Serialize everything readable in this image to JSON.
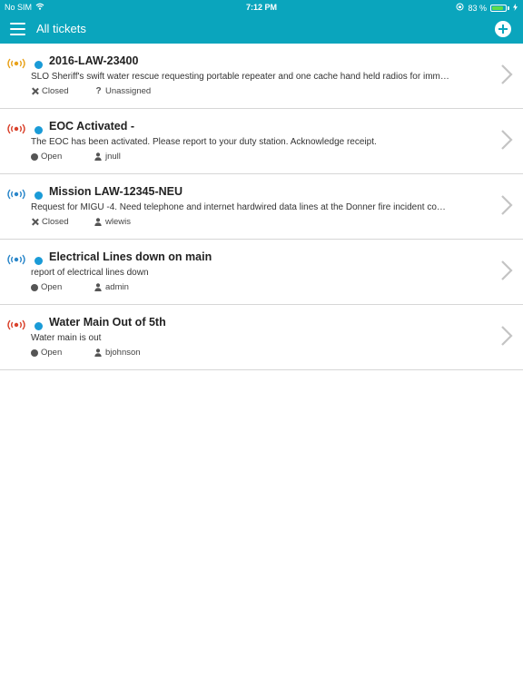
{
  "status_bar": {
    "carrier": "No SIM",
    "time": "7:12 PM",
    "battery_percent_text": "83 %",
    "battery_level": 0.83,
    "battery_color": "#5ddc4a"
  },
  "navbar": {
    "title": "All tickets",
    "background": "#0aa5bd",
    "menu_icon": "hamburger-menu-icon",
    "add_icon": "plus-circle-icon"
  },
  "tickets": [
    {
      "title": "2016-LAW-23400",
      "description": "SLO Sheriff's swift water rescue requesting portable repeater and one cache hand held radios for imm…",
      "status": "Closed",
      "status_icon": "close-icon",
      "assignee": "Unassigned",
      "assignee_icon": "question-icon",
      "priority_color": "#e8a21a",
      "unread_color": "#1a9bd7"
    },
    {
      "title": "EOC Activated -",
      "description": "The EOC has been activated. Please report to your duty station. Acknowledge receipt.",
      "status": "Open",
      "status_icon": "open-circle-icon",
      "assignee": "jnull",
      "assignee_icon": "person-icon",
      "priority_color": "#d9412b",
      "unread_color": "#1a9bd7"
    },
    {
      "title": "Mission LAW-12345-NEU",
      "description": "Request for MIGU -4. Need telephone and internet hardwired data lines at the Donner fire incident co…",
      "status": "Closed",
      "status_icon": "close-icon",
      "assignee": "wlewis",
      "assignee_icon": "person-icon",
      "priority_color": "#2a86c9",
      "unread_color": "#1a9bd7"
    },
    {
      "title": "Electrical Lines down on main",
      "description": "report of electrical lines down",
      "status": "Open",
      "status_icon": "open-circle-icon",
      "assignee": "admin",
      "assignee_icon": "person-icon",
      "priority_color": "#2a86c9",
      "unread_color": "#1a9bd7"
    },
    {
      "title": "Water Main Out of 5th",
      "description": "Water main is out",
      "status": "Open",
      "status_icon": "open-circle-icon",
      "assignee": "bjohnson",
      "assignee_icon": "person-icon",
      "priority_color": "#d9412b",
      "unread_color": "#1a9bd7"
    }
  ]
}
